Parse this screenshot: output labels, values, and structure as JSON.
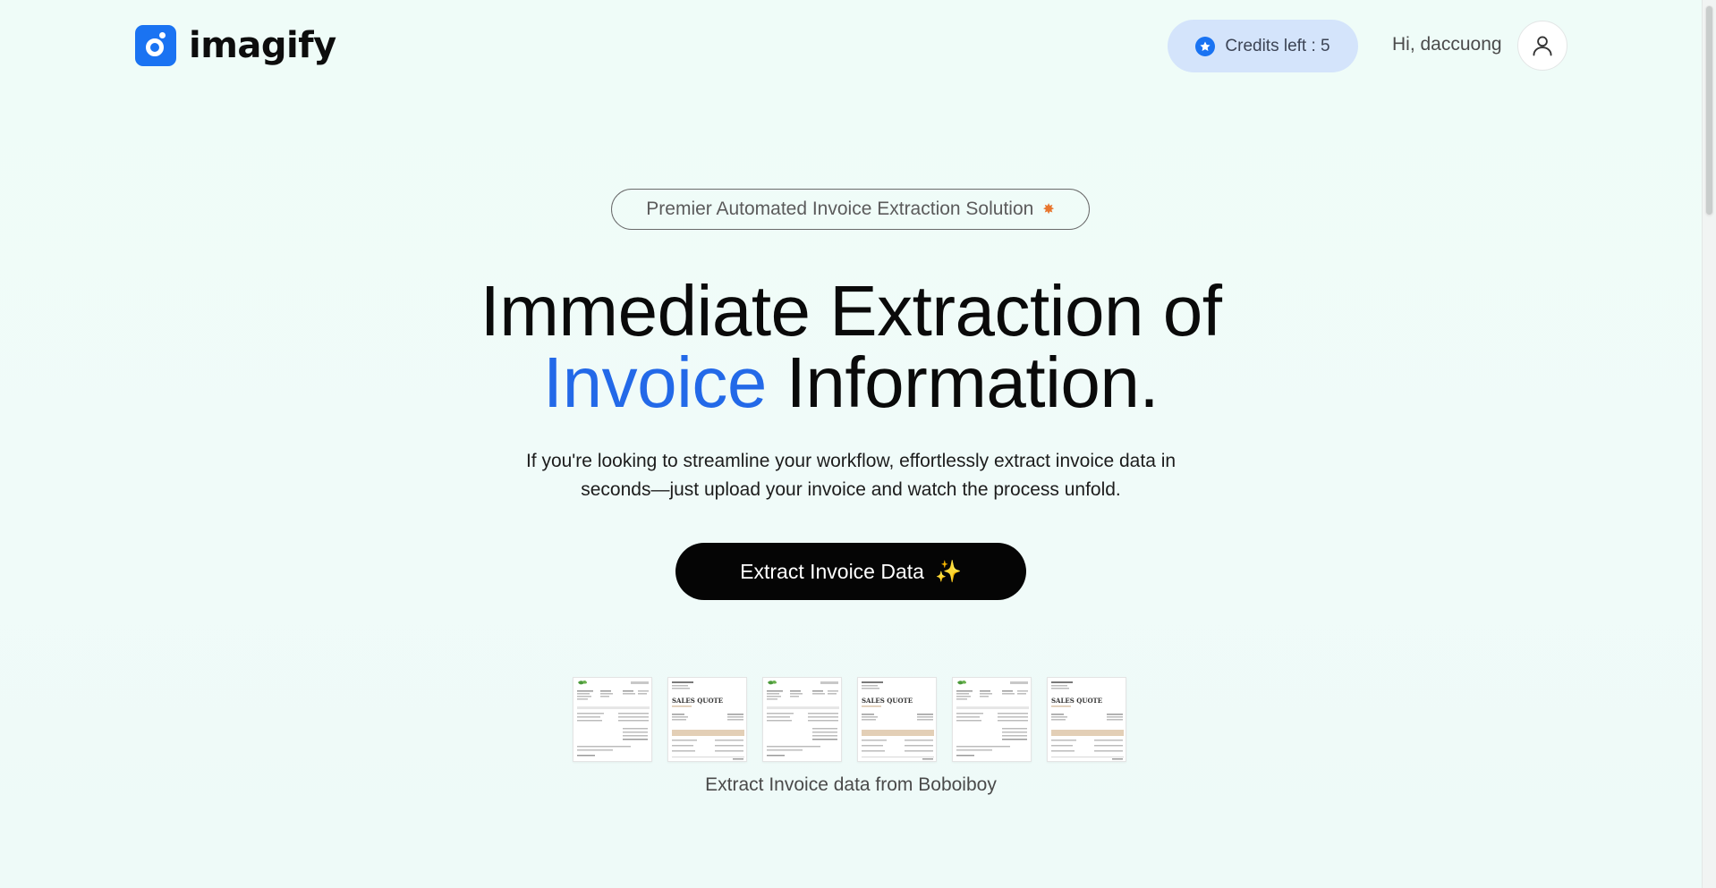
{
  "header": {
    "brand": "imagify",
    "credits_label": "Credits left : 5",
    "greeting": "Hi, daccuong"
  },
  "hero": {
    "tagline": "Premier Automated Invoice Extraction Solution",
    "title_line1": "Immediate Extraction of",
    "title_highlight": "Invoice",
    "title_line2_rest": "Information.",
    "subtitle": "If you're looking to streamline your workflow, effortlessly extract invoice data in seconds—just upload your invoice and watch the process unfold.",
    "cta_label": "Extract Invoice Data"
  },
  "samples": {
    "thumbnails": [
      {
        "kind": "invoice"
      },
      {
        "kind": "sales-quote"
      },
      {
        "kind": "invoice"
      },
      {
        "kind": "sales-quote"
      },
      {
        "kind": "invoice"
      },
      {
        "kind": "sales-quote"
      }
    ],
    "caption": "Extract Invoice data from Boboiboy"
  },
  "colors": {
    "accent": "#2369e8",
    "brand_blue": "#1a73f2",
    "credits_bg": "#d4e4fb",
    "cta_bg": "#050505"
  },
  "icons": {
    "logo": "camera-lens-icon",
    "credits": "star-icon",
    "avatar": "user-icon",
    "tagline": "sparkle-icon",
    "cta": "sparkles-icon"
  }
}
